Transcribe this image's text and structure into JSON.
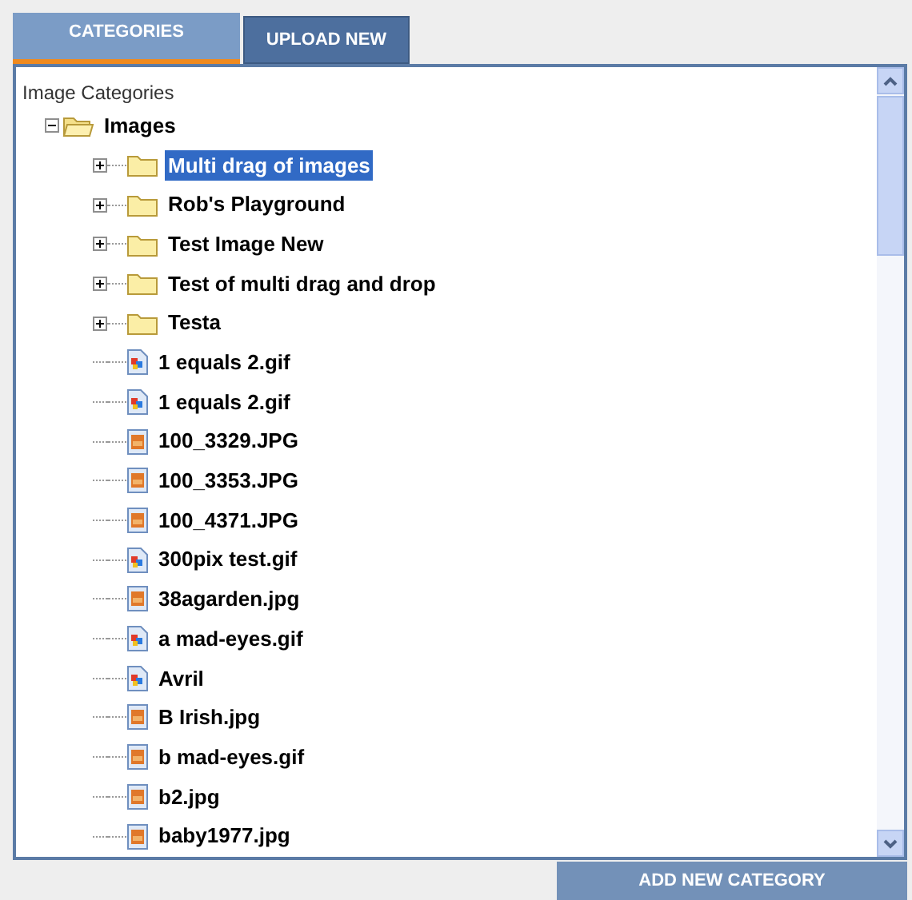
{
  "tabs": [
    {
      "label": "CATEGORIES",
      "selected": true
    },
    {
      "label": "UPLOAD NEW",
      "selected": false
    }
  ],
  "tree": {
    "heading": "Image Categories",
    "root": {
      "label": "Images",
      "kind": "folder",
      "expanded": true,
      "selected": false,
      "children": [
        {
          "label": "Multi drag of images",
          "kind": "folder",
          "expanded": false,
          "selected": true
        },
        {
          "label": "Rob's Playground",
          "kind": "folder",
          "expanded": false,
          "selected": false
        },
        {
          "label": "Test Image New",
          "kind": "folder",
          "expanded": false,
          "selected": false
        },
        {
          "label": "Test of multi drag and drop",
          "kind": "folder",
          "expanded": false,
          "selected": false
        },
        {
          "label": "Testa",
          "kind": "folder",
          "expanded": false,
          "selected": false
        },
        {
          "label": "1 equals 2.gif",
          "kind": "gif",
          "selected": false
        },
        {
          "label": "1 equals 2.gif",
          "kind": "gif",
          "selected": false
        },
        {
          "label": "100_3329.JPG",
          "kind": "jpg",
          "selected": false
        },
        {
          "label": "100_3353.JPG",
          "kind": "jpg",
          "selected": false
        },
        {
          "label": "100_4371.JPG",
          "kind": "jpg",
          "selected": false
        },
        {
          "label": "300pix test.gif",
          "kind": "gif",
          "selected": false
        },
        {
          "label": "38agarden.jpg",
          "kind": "jpg",
          "selected": false
        },
        {
          "label": "a mad-eyes.gif",
          "kind": "gif",
          "selected": false
        },
        {
          "label": "Avril",
          "kind": "gif",
          "selected": false
        },
        {
          "label": "B Irish.jpg",
          "kind": "jpg",
          "selected": false
        },
        {
          "label": "b mad-eyes.gif",
          "kind": "jpg",
          "selected": false
        },
        {
          "label": "b2.jpg",
          "kind": "jpg",
          "selected": false
        },
        {
          "label": "baby1977.jpg",
          "kind": "jpg",
          "selected": false
        }
      ]
    }
  },
  "add_button": "ADD NEW CATEGORY"
}
